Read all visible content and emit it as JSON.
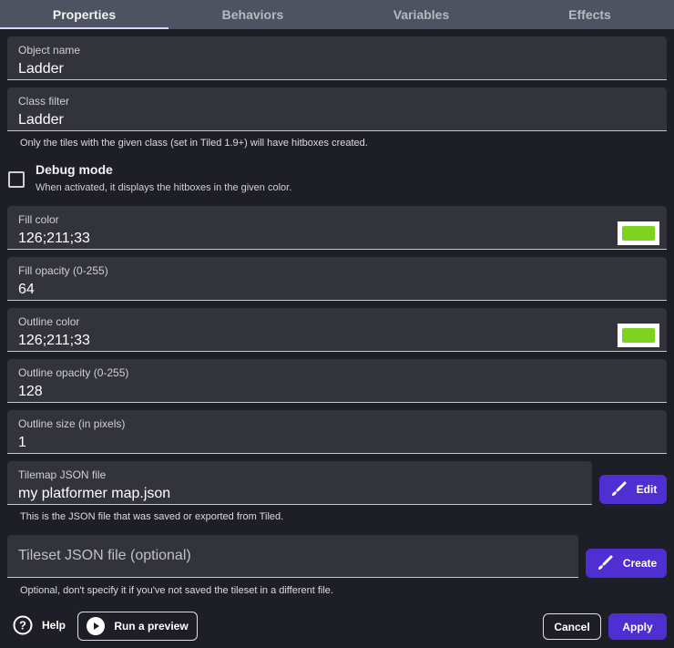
{
  "tabs": [
    {
      "label": "Properties",
      "active": true
    },
    {
      "label": "Behaviors",
      "active": false
    },
    {
      "label": "Variables",
      "active": false
    },
    {
      "label": "Effects",
      "active": false
    }
  ],
  "fields": {
    "object_name": {
      "label": "Object name",
      "value": "Ladder"
    },
    "class_filter": {
      "label": "Class filter",
      "value": "Ladder",
      "helper": "Only the tiles with the given class (set in Tiled 1.9+) will have hitboxes created."
    },
    "debug_mode": {
      "label": "Debug mode",
      "description": "When activated, it displays the hitboxes in the given color.",
      "checked": false
    },
    "fill_color": {
      "label": "Fill color",
      "value": "126;211;33",
      "swatch": "#7ed321"
    },
    "fill_opacity": {
      "label": "Fill opacity (0-255)",
      "value": "64"
    },
    "outline_color": {
      "label": "Outline color",
      "value": "126;211;33",
      "swatch": "#7ed321"
    },
    "outline_opacity": {
      "label": "Outline opacity (0-255)",
      "value": "128"
    },
    "outline_size": {
      "label": "Outline size (in pixels)",
      "value": "1"
    },
    "tilemap_json": {
      "label": "Tilemap JSON file",
      "value": "my platformer map.json",
      "helper": "This is the JSON file that was saved or exported from Tiled.",
      "button": "Edit"
    },
    "tileset_json": {
      "placeholder": "Tileset JSON file (optional)",
      "helper": "Optional, don't specify it if you've not saved the tileset in a different file.",
      "button": "Create"
    }
  },
  "footer": {
    "help": "Help",
    "preview": "Run a preview",
    "cancel": "Cancel",
    "apply": "Apply"
  },
  "colors": {
    "accent": "#4f2fd1",
    "swatch": "#7ed321"
  }
}
